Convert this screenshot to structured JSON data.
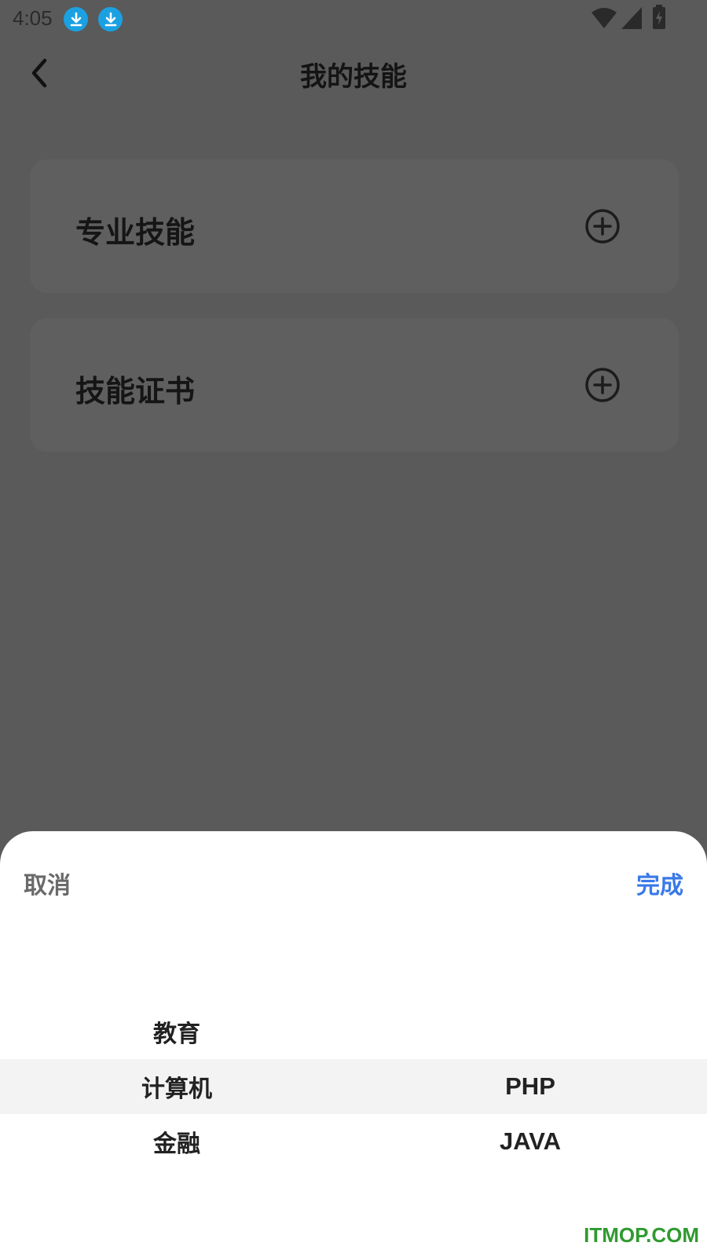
{
  "status_bar": {
    "time": "4:05",
    "notification_icons": [
      "download-icon",
      "download-icon"
    ],
    "right_icons": [
      "wifi-icon",
      "signal-icon",
      "battery-charging-icon"
    ]
  },
  "header": {
    "title": "我的技能",
    "back_icon": "chevron-left-icon"
  },
  "cards": [
    {
      "label": "专业技能",
      "action_icon": "add-circle-icon"
    },
    {
      "label": "技能证书",
      "action_icon": "add-circle-icon"
    }
  ],
  "picker_sheet": {
    "cancel_label": "取消",
    "done_label": "完成",
    "left_column": [
      "教育",
      "计算机",
      "金融"
    ],
    "right_column": [
      "",
      "PHP",
      "JAVA"
    ],
    "selected_left": "计算机",
    "selected_right": "PHP"
  },
  "watermark": "ITMOP.COM",
  "colors": {
    "overlay_background": "#5a5a5a",
    "accent": "#3a79e8",
    "download_badge": "#1ba1e2",
    "watermark": "#2f9a2f"
  }
}
